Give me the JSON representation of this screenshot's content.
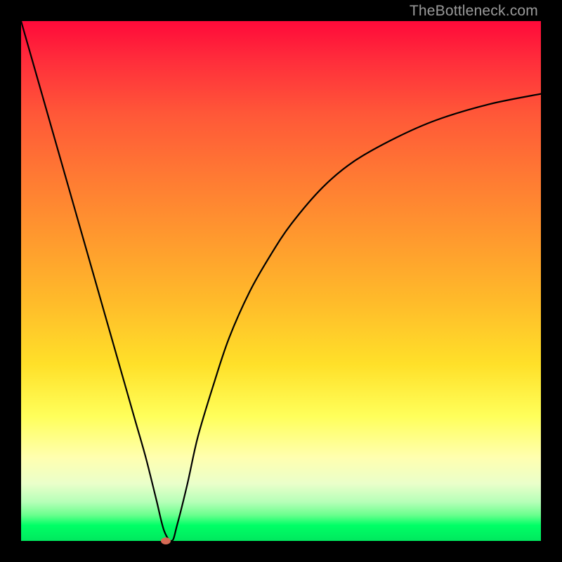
{
  "watermark": "TheBottleneck.com",
  "chart_data": {
    "type": "line",
    "title": "",
    "xlabel": "",
    "ylabel": "",
    "xlim": [
      0,
      100
    ],
    "ylim": [
      0,
      100
    ],
    "grid": false,
    "legend": false,
    "background_gradient": {
      "top": "#ff0a3a",
      "bottom": "#00e85e",
      "stops": [
        "red",
        "orange",
        "yellow",
        "green"
      ]
    },
    "series": [
      {
        "name": "bottleneck-curve",
        "color": "#000000",
        "x": [
          0,
          2,
          4,
          6,
          8,
          10,
          12,
          14,
          16,
          18,
          20,
          22,
          24,
          26,
          27.5,
          29,
          30,
          32,
          34,
          37,
          40,
          44,
          48,
          52,
          58,
          64,
          72,
          80,
          90,
          100
        ],
        "y": [
          100,
          93,
          86,
          79,
          72,
          65,
          58,
          51,
          44,
          37,
          30,
          23,
          16,
          8,
          2,
          0,
          3,
          11,
          20,
          30,
          39,
          48,
          55,
          61,
          68,
          73,
          77.5,
          81,
          84,
          86
        ]
      }
    ],
    "marker": {
      "name": "current-point",
      "x": 27.8,
      "y": 0,
      "color": "#d66a55"
    }
  }
}
